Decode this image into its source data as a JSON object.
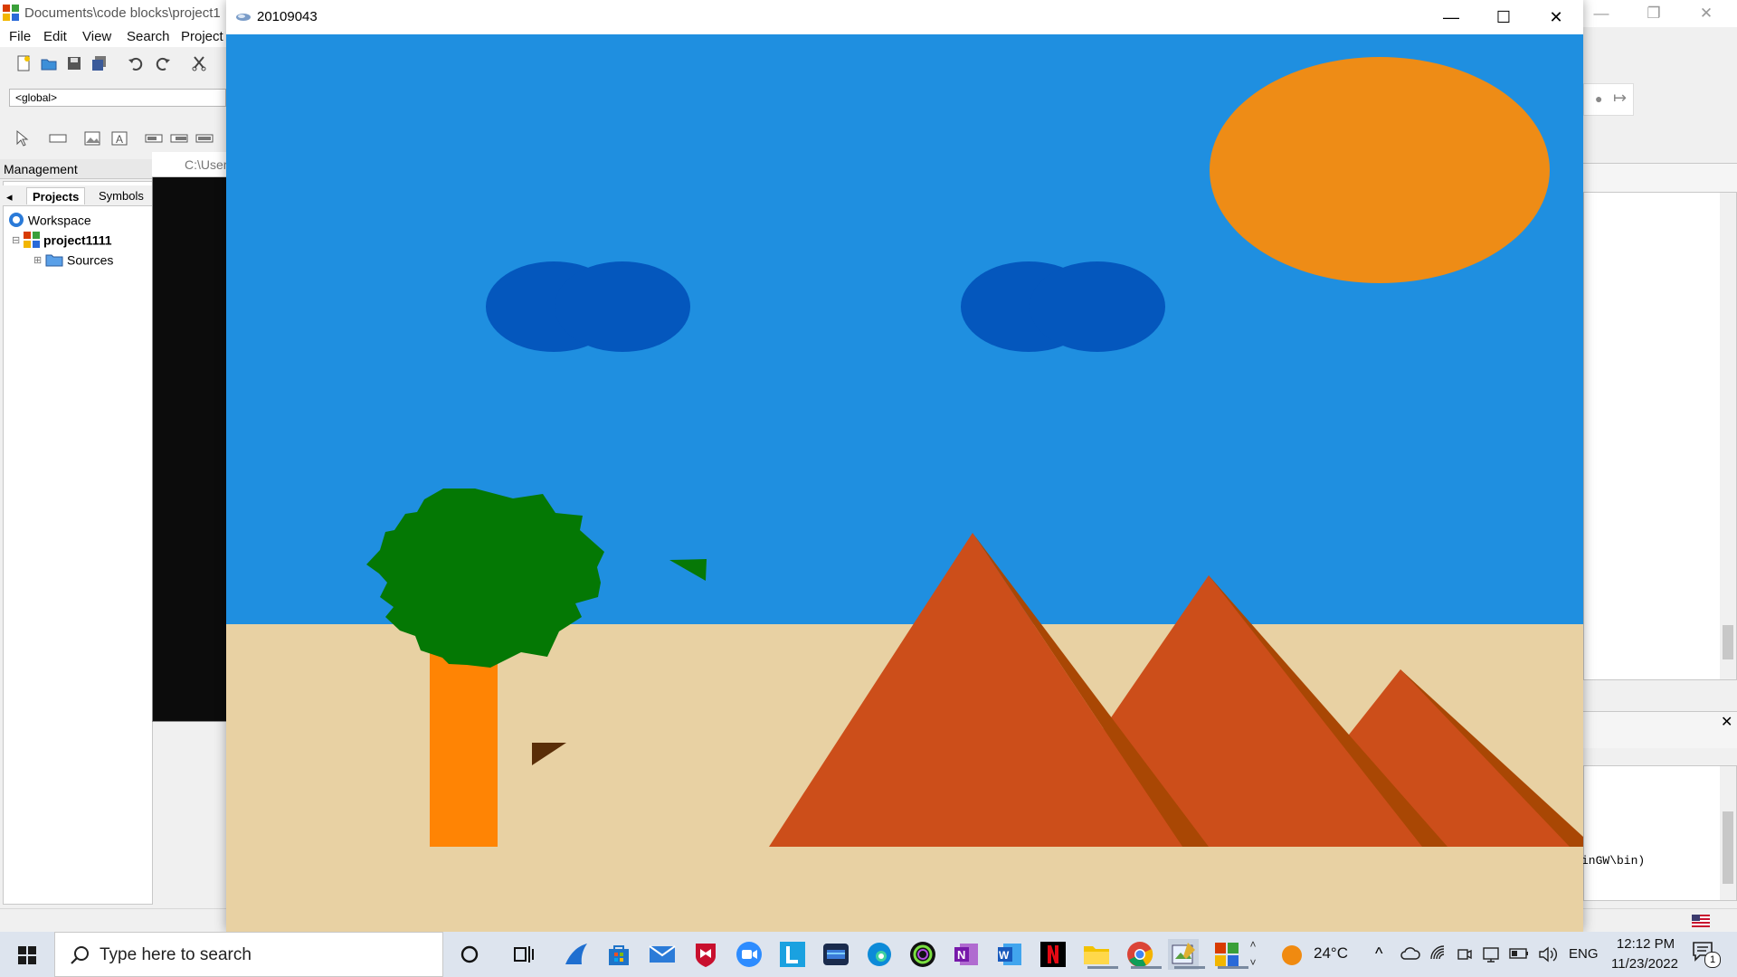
{
  "ide": {
    "title": "Documents\\code blocks\\project1",
    "menu": [
      "File",
      "Edit",
      "View",
      "Search",
      "Project"
    ],
    "global_combo": "<global>",
    "management": {
      "header": "Management",
      "tabs": [
        "Projects",
        "Symbols"
      ],
      "tree": [
        {
          "label": "Workspace"
        },
        {
          "label": "project1111"
        },
        {
          "label": "Sources"
        }
      ]
    },
    "console_title": "C:\\User",
    "log_text": "inGW\\bin)"
  },
  "graphics_window": {
    "title": "20109043",
    "scene": {
      "sky_color": "#1f8fe0",
      "ground_color": "#e8d1a3",
      "sun_color": "#ee8c16",
      "cloud_color": "#0457bd",
      "tree_foliage_color": "#047804",
      "tree_trunk_color": "#ff8404",
      "pyramid_color": "#cc4e1a",
      "pyramid_shadow_color": "#a94704",
      "bird_green_color": "#067806",
      "bird_brown_color": "#5a2e08"
    }
  },
  "taskbar": {
    "search_placeholder": "Type here to search",
    "weather_temp": "24°C",
    "language": "ENG",
    "time": "12:12 PM",
    "date": "11/23/2022",
    "notification_count": "1",
    "apps": [
      "cortana",
      "task-view",
      "app-shark",
      "microsoft-store",
      "mail",
      "mcafee",
      "zoom",
      "app-l",
      "app-media",
      "edge",
      "app-ring",
      "onenote",
      "word",
      "netflix",
      "file-explorer",
      "chrome",
      "paint",
      "codeblocks"
    ]
  }
}
